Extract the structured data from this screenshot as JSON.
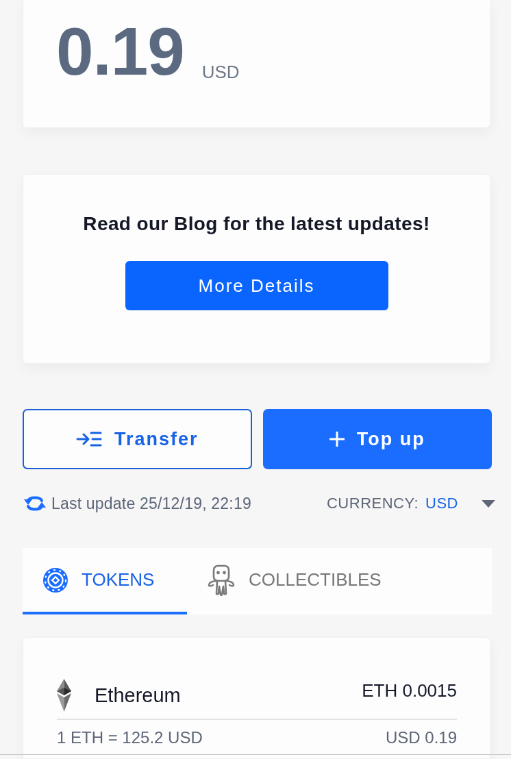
{
  "balance": {
    "amount": "0.19",
    "currency": "USD"
  },
  "promo": {
    "title": "Read our Blog for the latest updates!",
    "button": "More Details"
  },
  "actions": [
    {
      "kind": "outline",
      "label": "Transfer"
    },
    {
      "kind": "primary",
      "label": "Top up"
    }
  ],
  "status": {
    "last_update": "Last update 25/12/19, 22:19",
    "currency_label": "CURRENCY:",
    "currency_value": "USD"
  },
  "tabs": [
    {
      "label": "TOKENS",
      "selected": true
    },
    {
      "label": "COLLECTIBLES",
      "selected": false
    }
  ],
  "tokens": [
    {
      "name": "Ethereum",
      "balance": "ETH 0.0015",
      "rate": "1 ETH = 125.2 USD",
      "value": "USD 0.19"
    }
  ]
}
